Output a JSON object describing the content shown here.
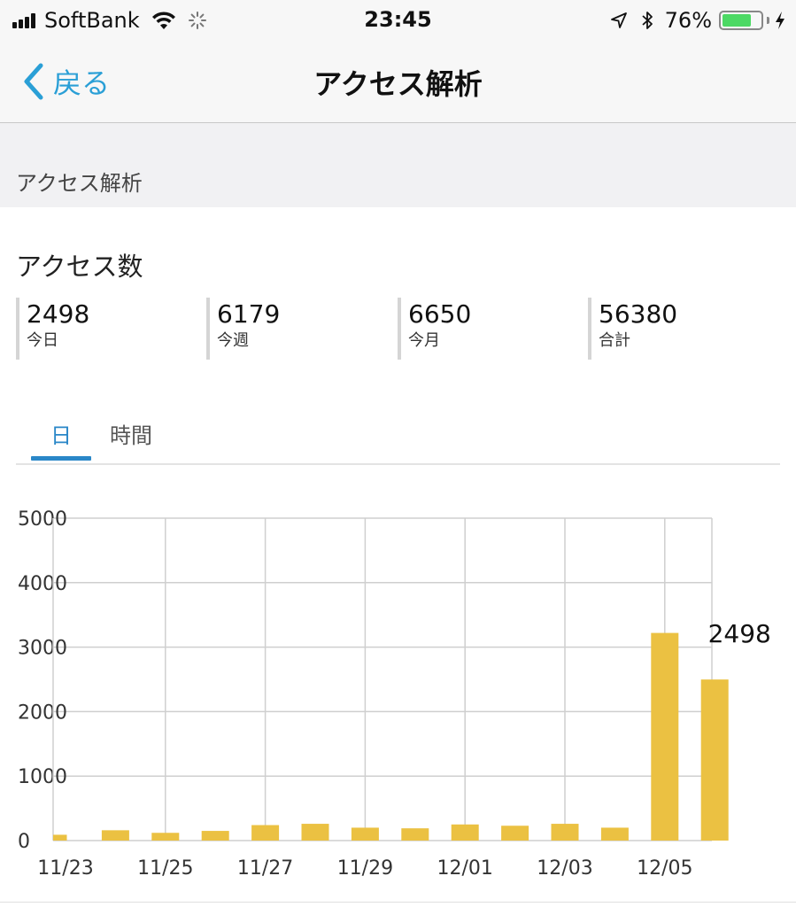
{
  "status_bar": {
    "carrier": "SoftBank",
    "time": "23:45",
    "battery_percent": "76%",
    "battery_level": 0.76,
    "icons": [
      "signal-icon",
      "wifi-icon",
      "activity-spinner-icon",
      "location-arrow-icon",
      "bluetooth-icon",
      "battery-icon",
      "charging-bolt-icon"
    ]
  },
  "nav": {
    "back_label": "戻る",
    "title": "アクセス解析"
  },
  "section": {
    "header": "アクセス解析"
  },
  "access": {
    "title": "アクセス数",
    "stats": [
      {
        "value": "2498",
        "label": "今日"
      },
      {
        "value": "6179",
        "label": "今週"
      },
      {
        "value": "6650",
        "label": "今月"
      },
      {
        "value": "56380",
        "label": "合計"
      }
    ]
  },
  "tabs": [
    {
      "label": "日",
      "active": true
    },
    {
      "label": "時間",
      "active": false
    }
  ],
  "colors": {
    "accent": "#2a87c8",
    "back_link": "#2a9fd6",
    "bar": "#ebc142",
    "grid": "#cfcfcf"
  },
  "chart_data": {
    "type": "bar",
    "categories": [
      "11/23",
      "11/24",
      "11/25",
      "11/26",
      "11/27",
      "11/28",
      "11/29",
      "11/30",
      "12/01",
      "12/02",
      "12/03",
      "12/04",
      "12/05",
      "12/06"
    ],
    "x_tick_labels": [
      "11/23",
      "11/25",
      "11/27",
      "11/29",
      "12/01",
      "12/03",
      "12/05"
    ],
    "values": [
      90,
      160,
      120,
      150,
      240,
      260,
      200,
      190,
      250,
      230,
      260,
      200,
      3220,
      2498
    ],
    "y_ticks": [
      "0",
      "1000",
      "2000",
      "3000",
      "4000",
      "5000"
    ],
    "ylim": [
      0,
      5000
    ],
    "grid": true,
    "data_label": {
      "index": 13,
      "text": "2498"
    }
  }
}
